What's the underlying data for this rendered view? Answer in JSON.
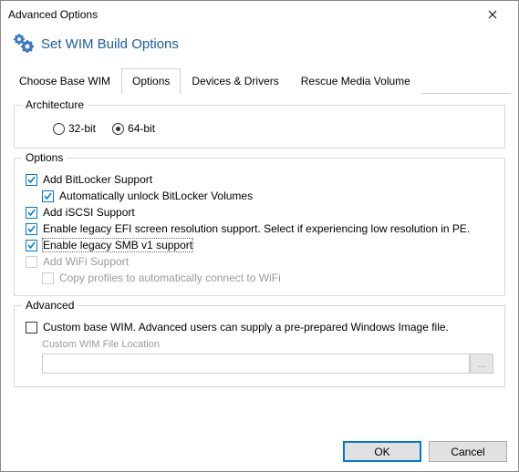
{
  "window": {
    "title": "Advanced Options",
    "header": "Set WIM Build Options"
  },
  "tabs": {
    "base": "Choose Base WIM",
    "options": "Options",
    "devices": "Devices & Drivers",
    "rescue": "Rescue Media Volume"
  },
  "arch": {
    "legend": "Architecture",
    "r32": "32-bit",
    "r64": "64-bit"
  },
  "options": {
    "legend": "Options",
    "bitlocker": "Add BitLocker Support",
    "bitlocker_auto": "Automatically unlock BitLocker Volumes",
    "iscsi": "Add iSCSI Support",
    "efi": "Enable legacy EFI screen resolution support.  Select if experiencing low resolution in PE.",
    "smb": "Enable legacy SMB v1 support",
    "wifi": "Add WiFi Support",
    "wifi_copy": "Copy profiles to automatically connect to WiFi"
  },
  "advanced": {
    "legend": "Advanced",
    "custom": "Custom base WIM. Advanced users can supply a pre-prepared Windows Image file.",
    "location_label": "Custom WIM File Location",
    "browse": "..."
  },
  "buttons": {
    "ok": "OK",
    "cancel": "Cancel"
  }
}
